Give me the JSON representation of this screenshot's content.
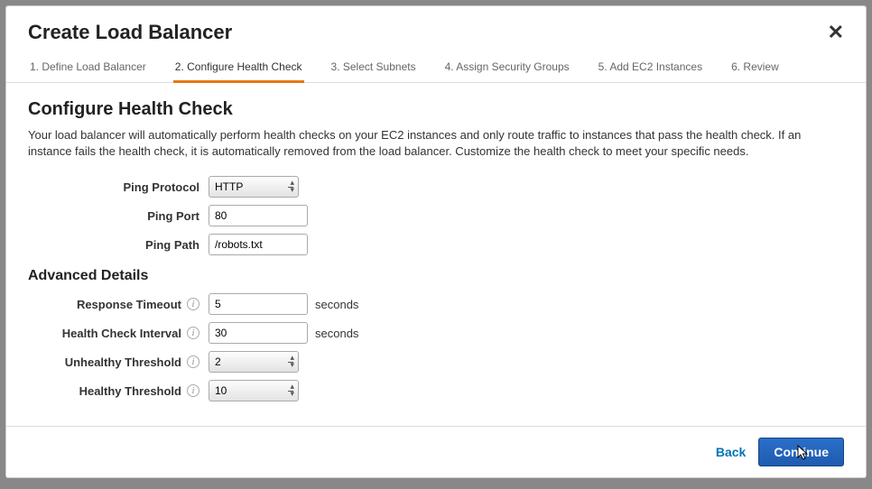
{
  "header": {
    "title": "Create Load Balancer"
  },
  "tabs": [
    {
      "label": "1. Define Load Balancer"
    },
    {
      "label": "2. Configure Health Check"
    },
    {
      "label": "3. Select Subnets"
    },
    {
      "label": "4. Assign Security Groups"
    },
    {
      "label": "5. Add EC2 Instances"
    },
    {
      "label": "6. Review"
    }
  ],
  "section": {
    "title": "Configure Health Check",
    "description": "Your load balancer will automatically perform health checks on your EC2 instances and only route traffic to instances that pass the health check. If an instance fails the health check, it is automatically removed from the load balancer. Customize the health check to meet your specific needs."
  },
  "fields": {
    "ping_protocol": {
      "label": "Ping Protocol",
      "value": "HTTP"
    },
    "ping_port": {
      "label": "Ping Port",
      "value": "80"
    },
    "ping_path": {
      "label": "Ping Path",
      "value": "/robots.txt"
    }
  },
  "advanced": {
    "heading": "Advanced Details",
    "response_timeout": {
      "label": "Response Timeout",
      "value": "5",
      "unit": "seconds"
    },
    "health_check_interval": {
      "label": "Health Check Interval",
      "value": "30",
      "unit": "seconds"
    },
    "unhealthy_threshold": {
      "label": "Unhealthy Threshold",
      "value": "2"
    },
    "healthy_threshold": {
      "label": "Healthy Threshold",
      "value": "10"
    }
  },
  "footer": {
    "back": "Back",
    "continue": "Continue"
  }
}
